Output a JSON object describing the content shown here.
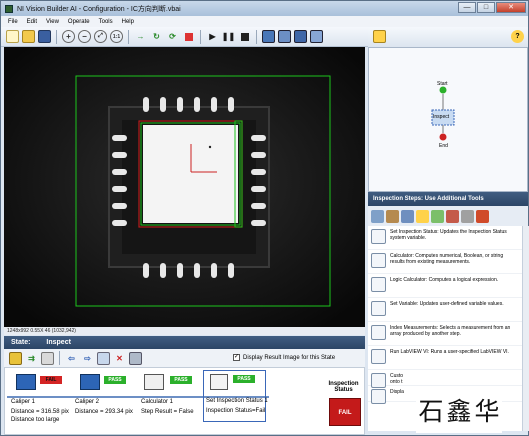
{
  "window": {
    "title": "NI Vision Builder AI - Configuration - IC方向判断.vbai",
    "minimize": "—",
    "maximize": "□",
    "close": "✕"
  },
  "menu": [
    "File",
    "Edit",
    "View",
    "Operate",
    "Tools",
    "Help"
  ],
  "toolbar": {
    "icons": [
      "new-icon",
      "open-icon",
      "save-icon",
      "zoom-in-icon",
      "zoom-out-icon",
      "zoom-fit-icon",
      "zoom-1to1-icon",
      "next-step-icon",
      "run-icon",
      "loop-icon",
      "stop-icon",
      "run-pause-icon",
      "pause-icon",
      "stop-square-icon",
      "view-icon",
      "view2-icon",
      "view3-icon",
      "view4-icon",
      "diagram-icon",
      "help-icon"
    ]
  },
  "image": {
    "coords": "1248x992 0.55X 46   (1032,942)"
  },
  "flow": {
    "start": "Start",
    "state": "Inspect",
    "end": "End"
  },
  "steps_panel": {
    "title": "Inspection Steps: Use Additional Tools",
    "items": [
      {
        "text": "Set Inspection Status:  Updates the Inspection Status system variable."
      },
      {
        "text": "Calculator:  Computes numerical, Boolean, or string results from existing measurements."
      },
      {
        "text": "Logic Calculator:  Computes a logical expression."
      },
      {
        "text": "Set Variable:  Updates user-defined variable values."
      },
      {
        "text": "Index Measurements:  Selects a measurement from an array produced by another step."
      },
      {
        "text": "Run LabVIEW VI:  Runs a user-specified LabVIEW VI."
      },
      {
        "text": "Custo"
      },
      {
        "text": "onto t"
      },
      {
        "text": "Displa"
      }
    ]
  },
  "state": {
    "label": "State:",
    "name": "Inspect"
  },
  "state_tools": {
    "display_check": "Display Result Image for this State",
    "checked": "✓"
  },
  "steps": [
    {
      "name": "Caliper 1",
      "tag": "FAIL",
      "v1": "Distance = 316.58 pix",
      "v2": "Distance too large",
      "status_color": "#d42424"
    },
    {
      "name": "Caliper 2",
      "tag": "PASS",
      "v1": "Distance = 293.34 pix",
      "v2": "",
      "status_color": "#2bb02b"
    },
    {
      "name": "Calculator 1",
      "tag": "PASS",
      "v1": "Step Result = False",
      "v2": "",
      "status_color": "#2bb02b"
    },
    {
      "name": "Set Inspection Status 1",
      "tag": "PASS",
      "v1": "Inspection Status=Fail",
      "v2": "",
      "status_color": "#2bb02b"
    }
  ],
  "inspection": {
    "label": "Inspection Status",
    "result": "FAIL"
  },
  "logo": {
    "chars": [
      "石",
      "鑫",
      "华"
    ]
  }
}
